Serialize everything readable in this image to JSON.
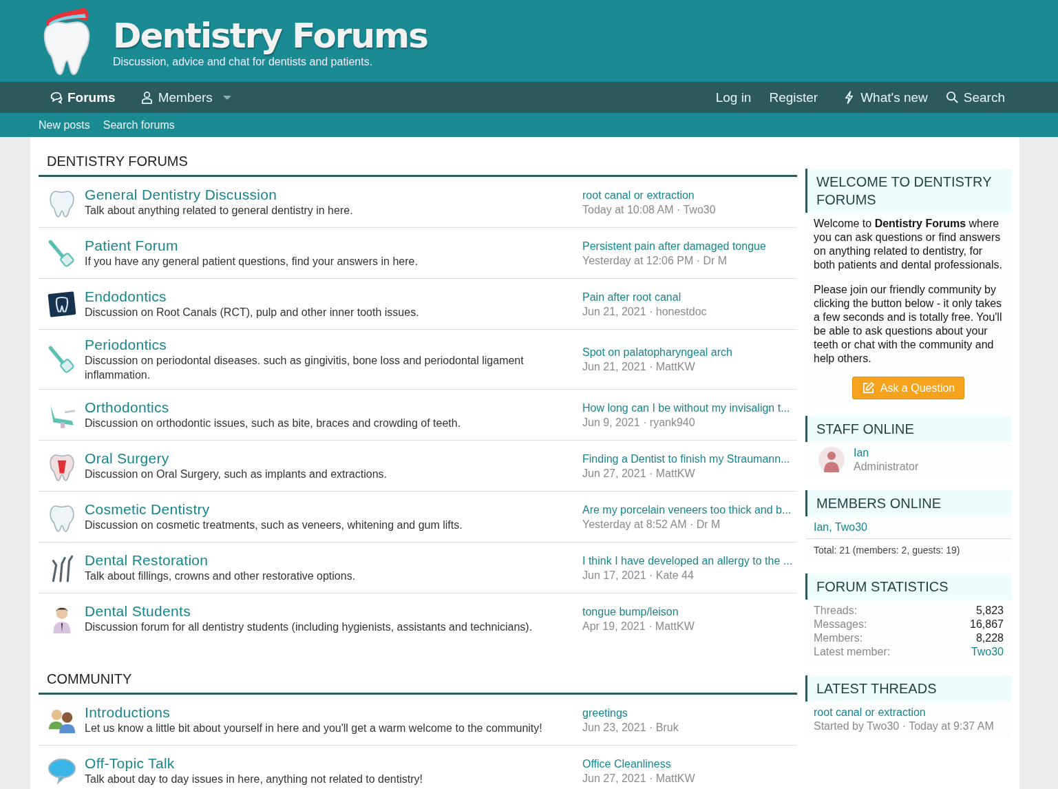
{
  "header": {
    "title": "Dentistry Forums",
    "tagline": "Discussion, advice and chat for dentists and patients."
  },
  "nav": {
    "left": [
      {
        "label": "Forums",
        "selected": true,
        "kind": "forums"
      },
      {
        "label": "Members",
        "selected": false,
        "kind": "members"
      }
    ],
    "right": [
      {
        "label": "Log in",
        "kind": "plain"
      },
      {
        "label": "Register",
        "kind": "plain"
      },
      {
        "label": "What's new",
        "kind": "bolt"
      },
      {
        "label": "Search",
        "kind": "search"
      }
    ]
  },
  "subnav": [
    "New posts",
    "Search forums"
  ],
  "sections": [
    {
      "title": "DENTISTRY FORUMS",
      "forums": [
        {
          "name": "General Dentistry Discussion",
          "description": "Talk about anything related to general dentistry in here.",
          "last_thread": "root canal or extraction",
          "last_meta": "Today at 10:08 AM · Two30"
        },
        {
          "name": "Patient Forum",
          "description": "If you have any general patient questions, find your answers in here.",
          "last_thread": "Persistent pain after damaged tongue",
          "last_meta": "Yesterday at 12:06 PM · Dr M"
        },
        {
          "name": "Endodontics",
          "description": "Discussion on Root Canals (RCT), pulp and other inner tooth issues.",
          "last_thread": "Pain after root canal",
          "last_meta": "Jun 21, 2021 · honestdoc"
        },
        {
          "name": "Periodontics",
          "description": "Discussion on periodontal diseases. such as gingivitis, bone loss and periodontal ligament inflammation.",
          "last_thread": "Spot on palatopharyngeal arch",
          "last_meta": "Jun 21, 2021 · MattKW"
        },
        {
          "name": "Orthodontics",
          "description": "Discussion on orthodontic issues, such as bite, braces and crowding of teeth.",
          "last_thread": "How long can I be without my invisalign t...",
          "last_meta": "Jun 9, 2021 · ryank940"
        },
        {
          "name": "Oral Surgery",
          "description": "Discussion on Oral Surgery, such as implants and extractions.",
          "last_thread": "Finding a Dentist to finish my Straumann...",
          "last_meta": "Jun 27, 2021 · MattKW"
        },
        {
          "name": "Cosmetic Dentistry",
          "description": "Discussion on cosmetic treatments, such as veneers, whitening and gum lifts.",
          "last_thread": "Are my porcelain veneers too thick and b...",
          "last_meta": "Yesterday at 8:52 AM · Dr M"
        },
        {
          "name": "Dental Restoration",
          "description": "Talk about fillings, crowns and other restorative options.",
          "last_thread": "I think I have developed an allergy to the ...",
          "last_meta": "Jun 17, 2021 · Kate 44"
        },
        {
          "name": "Dental Students",
          "description": "Discussion forum for all dentistry students (including hygienists, assistants and technicians).",
          "last_thread": "tongue bump/leison",
          "last_meta": "Apr 19, 2021 · MattKW"
        }
      ]
    },
    {
      "title": "COMMUNITY",
      "forums": [
        {
          "name": "Introductions",
          "description": "Let us know a little bit about yourself in here and you'll get a warm welcome to the community!",
          "last_thread": "greetings",
          "last_meta": "Jun 23, 2021 · Bruk"
        },
        {
          "name": "Off-Topic Talk",
          "description": "Talk about day to day issues in here, anything not related to dentistry!",
          "last_thread": "Office Cleanliness",
          "last_meta": "Jun 27, 2021 · MattKW"
        }
      ]
    }
  ],
  "sidebar": {
    "welcome": {
      "title": "WELCOME TO DENTISTRY FORUMS",
      "paragraphs": [
        "Welcome to **Dentistry Forums** where you can ask questions or find answers on anything related to dentistry, for both patients and dental professionals.",
        "Please join our friendly community by clicking the button below - it only takes a few seconds and is totally free. You'll be able to ask questions about your teeth or chat with the community and help others."
      ],
      "button": "Ask a Question"
    },
    "staff": {
      "title": "STAFF ONLINE",
      "members": [
        {
          "name": "Ian",
          "role": "Administrator"
        }
      ]
    },
    "members_online": {
      "title": "MEMBERS ONLINE",
      "names": "Ian, Two30",
      "total": "Total: 21 (members: 2, guests: 19)"
    },
    "stats": {
      "title": "FORUM STATISTICS",
      "rows": [
        {
          "label": "Threads:",
          "value": "5,823",
          "kind": "text"
        },
        {
          "label": "Messages:",
          "value": "16,867",
          "kind": "text"
        },
        {
          "label": "Members:",
          "value": "8,228",
          "kind": "text"
        },
        {
          "label": "Latest member:",
          "value": "Two30",
          "kind": "link"
        }
      ]
    },
    "latest": {
      "title": "LATEST THREADS",
      "threads": [
        {
          "title": "root canal or extraction",
          "meta": "Started by Two30 · Today at 9:37 AM"
        }
      ]
    }
  }
}
